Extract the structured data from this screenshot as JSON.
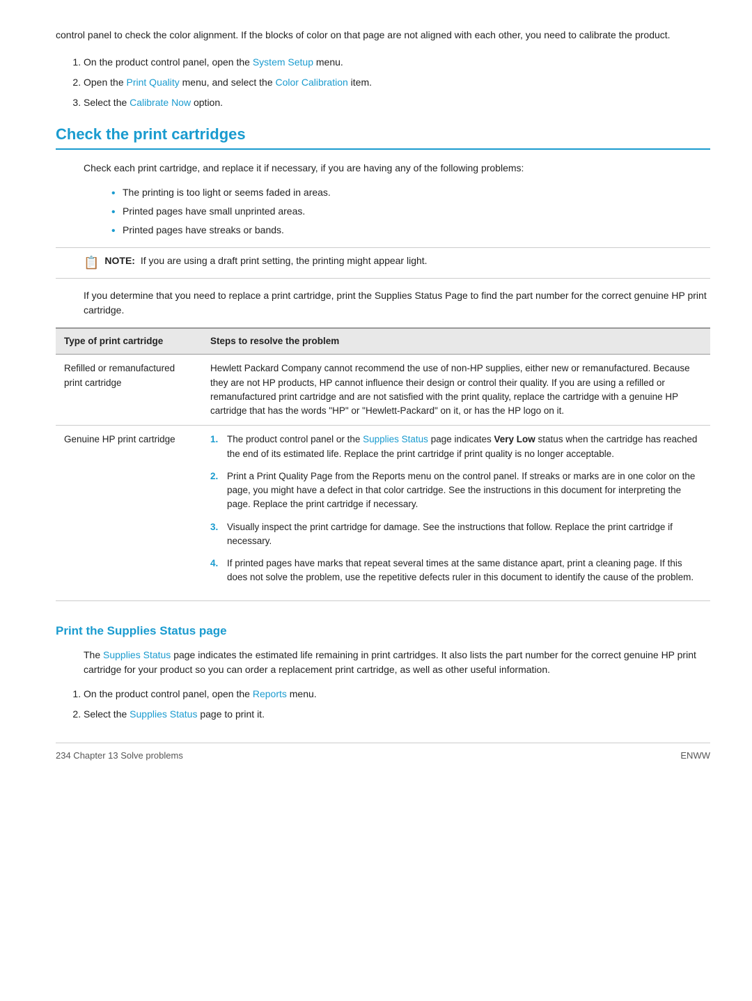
{
  "intro": {
    "text": "control panel to check the color alignment. If the blocks of color on that page are not aligned with each other, you need to calibrate the product."
  },
  "calibrate_steps": [
    {
      "number": "1.",
      "text": "On the product control panel, open the ",
      "link": "System Setup",
      "text2": " menu."
    },
    {
      "number": "2.",
      "text": "Open the ",
      "link1": "Print Quality",
      "text2": " menu, and select the ",
      "link2": "Color Calibration",
      "text3": " item."
    },
    {
      "number": "3.",
      "text": "Select the ",
      "link": "Calibrate Now",
      "text2": " option."
    }
  ],
  "section1": {
    "heading": "Check the print cartridges",
    "body": "Check each print cartridge, and replace it if necessary, if you are having any of the following problems:",
    "bullets": [
      "The printing is too light or seems faded in areas.",
      "Printed pages have small unprinted areas.",
      "Printed pages have streaks or bands."
    ],
    "note": {
      "label": "NOTE:",
      "text": "If you are using a draft print setting, the printing might appear light."
    },
    "supplies_text": "If you determine that you need to replace a print cartridge, print the Supplies Status Page to find the part number for the correct genuine HP print cartridge.",
    "table": {
      "col1_header": "Type of print cartridge",
      "col2_header": "Steps to resolve the problem",
      "rows": [
        {
          "type": "Refilled or remanufactured print cartridge",
          "steps_text": "Hewlett Packard Company cannot recommend the use of non-HP supplies, either new or remanufactured. Because they are not HP products, HP cannot influence their design or control their quality. If you are using a refilled or remanufactured print cartridge and are not satisfied with the print quality, replace the cartridge with a genuine HP cartridge that has the words \"HP\" or \"Hewlett-Packard\" on it, or has the HP logo on it."
        },
        {
          "type": "Genuine HP print cartridge",
          "steps_numbered": [
            {
              "num": "1.",
              "text_before": "The product control panel or the ",
              "link": "Supplies Status",
              "text_after": " page indicates Very Low status when the cartridge has reached the end of its estimated life. Replace the print cartridge if print quality is no longer acceptable.",
              "bold_text": "Very Low"
            },
            {
              "num": "2.",
              "text": "Print a Print Quality Page from the Reports menu on the control panel. If streaks or marks are in one color on the page, you might have a defect in that color cartridge. See the instructions in this document for interpreting the page. Replace the print cartridge if necessary."
            },
            {
              "num": "3.",
              "text": "Visually inspect the print cartridge for damage. See the instructions that follow. Replace the print cartridge if necessary."
            },
            {
              "num": "4.",
              "text": "If printed pages have marks that repeat several times at the same distance apart, print a cleaning page. If this does not solve the problem, use the repetitive defects ruler in this document to identify the cause of the problem."
            }
          ]
        }
      ]
    }
  },
  "section2": {
    "heading": "Print the Supplies Status page",
    "body_before": "The ",
    "link1": "Supplies Status",
    "body_middle": " page indicates the estimated life remaining in print cartridges. It also lists the part number for the correct genuine HP print cartridge for your product so you can order a replacement print cartridge, as well as other useful information.",
    "steps": [
      {
        "number": "1.",
        "text": "On the product control panel, open the ",
        "link": "Reports",
        "text2": " menu."
      },
      {
        "number": "2.",
        "text": "Select the ",
        "link": "Supplies Status",
        "text2": " page to print it."
      }
    ]
  },
  "footer": {
    "left": "234  Chapter 13  Solve problems",
    "right": "ENWW"
  }
}
